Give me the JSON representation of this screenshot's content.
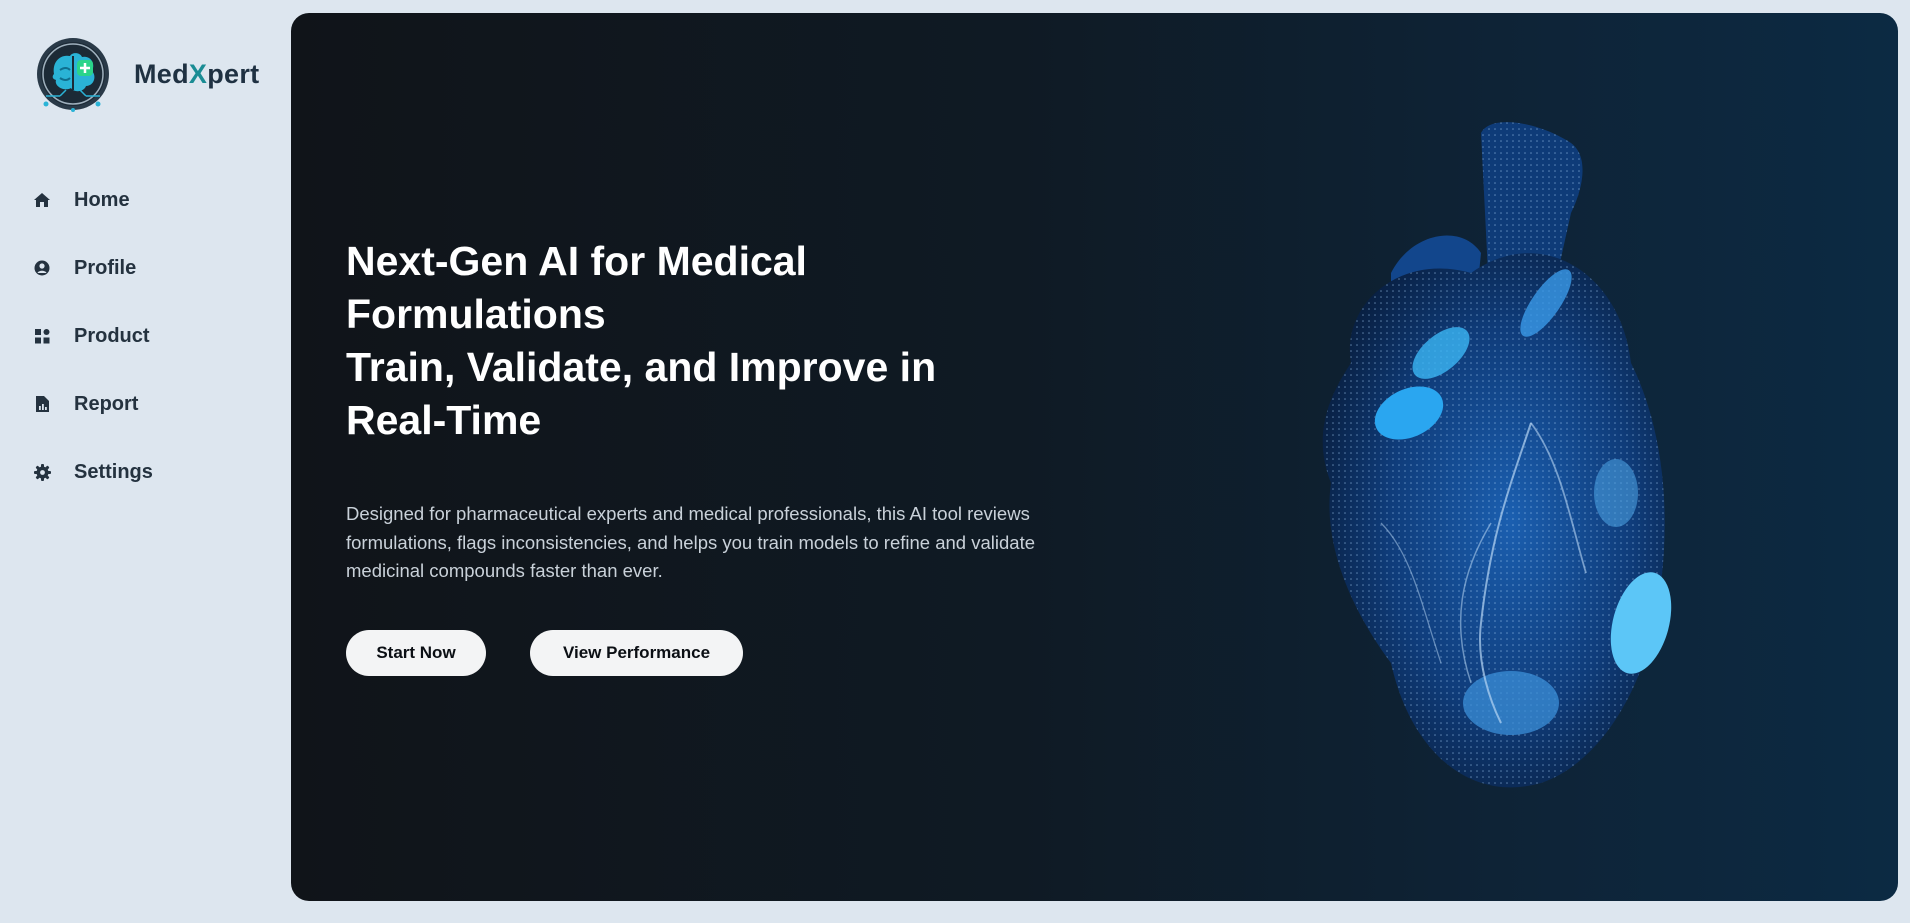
{
  "brand": {
    "name_prefix": "Med",
    "name_x": "X",
    "name_suffix": "pert"
  },
  "sidebar": {
    "items": [
      {
        "label": "Home",
        "icon": "home-icon"
      },
      {
        "label": "Profile",
        "icon": "user-circle-icon"
      },
      {
        "label": "Product",
        "icon": "grid-icon"
      },
      {
        "label": "Report",
        "icon": "report-file-icon"
      },
      {
        "label": "Settings",
        "icon": "gear-icon"
      }
    ]
  },
  "hero": {
    "headline_lines": [
      "Next-Gen AI for Medical",
      "Formulations",
      "Train, Validate, and Improve in",
      "Real-Time"
    ],
    "description": "Designed for pharmaceutical experts and medical professionals, this AI tool reviews formulations, flags inconsistencies, and helps you train models to refine and validate medicinal compounds faster than ever.",
    "primary_button": "Start Now",
    "secondary_button": "View Performance",
    "illustration": "glowing-heart-illustration"
  },
  "colors": {
    "page_bg": "#dde6ef",
    "brand_accent": "#1a8c94",
    "text_dark": "#24323f",
    "hero_bg_left": "#101419",
    "hero_bg_right": "#0c2a43",
    "heart_blue": "#1e7fd6",
    "button_bg": "#f3f4f5"
  }
}
